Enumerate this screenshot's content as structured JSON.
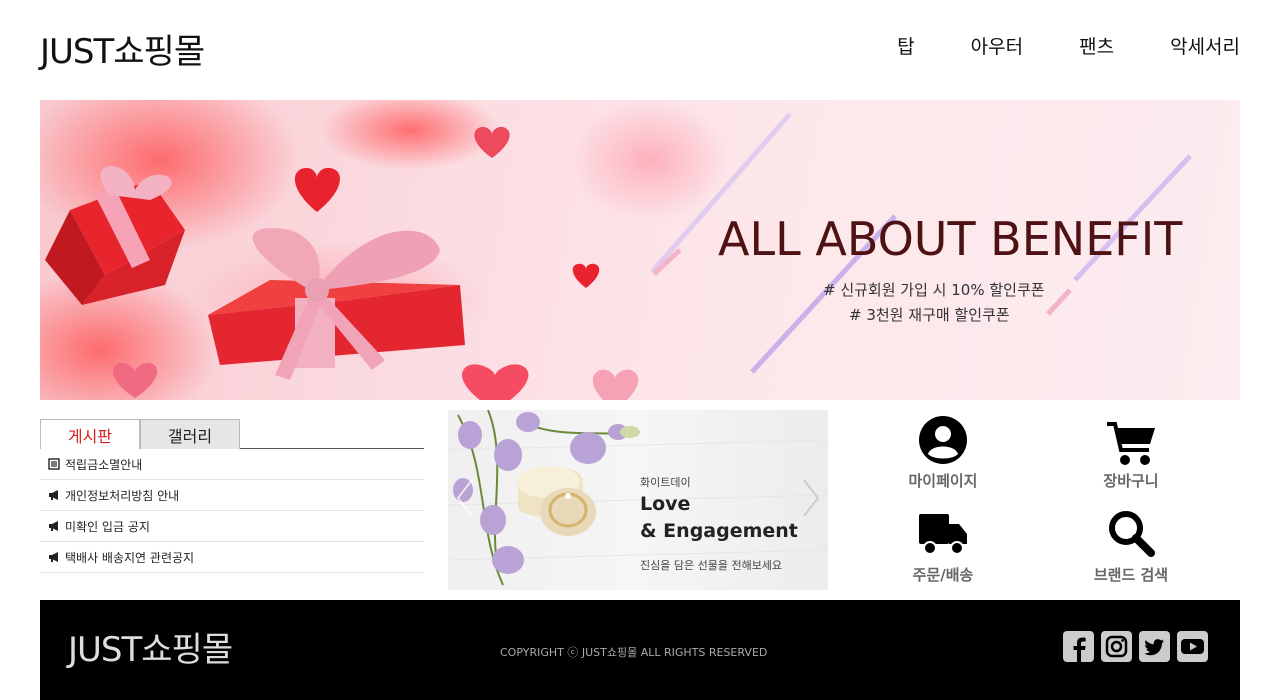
{
  "header": {
    "logo": "JUST쇼핑몰",
    "nav": [
      "탑",
      "아우터",
      "팬츠",
      "악세서리"
    ]
  },
  "banner": {
    "title": "ALL ABOUT BENEFIT",
    "line1": "# 신규회원 가입 시 10% 할인쿠폰",
    "line2": "# 3천원 재구매 할인쿠폰"
  },
  "board": {
    "tabs": [
      "게시판",
      "갤러리"
    ],
    "items": [
      {
        "icon": "list-icon",
        "text": "적립금소멸안내"
      },
      {
        "icon": "megaphone-icon",
        "text": "개인정보처리방침 안내"
      },
      {
        "icon": "megaphone-icon",
        "text": "미확인 입금 공지"
      },
      {
        "icon": "megaphone-icon",
        "text": "택배사 배송지연 관련공지"
      }
    ]
  },
  "promo": {
    "sub": "화이트데이",
    "title1": "Love",
    "title2": "&  Engagement",
    "desc": "진심을 담은 선물을 전해보세요"
  },
  "quick": [
    {
      "icon": "user-circle-icon",
      "label": "마이페이지"
    },
    {
      "icon": "cart-icon",
      "label": "장바구니"
    },
    {
      "icon": "truck-icon",
      "label": "주문/배송"
    },
    {
      "icon": "search-icon",
      "label": "브랜드 검색"
    }
  ],
  "footer": {
    "logo": "JUST쇼핑몰",
    "copyright": "COPYRIGHT ⓒ JUST쇼핑몰 ALL RIGHTS RESERVED",
    "social": [
      "facebook-icon",
      "instagram-icon",
      "twitter-icon",
      "youtube-icon"
    ]
  },
  "colors": {
    "accent_tab": "#d42020",
    "banner_title": "#4e1214",
    "footer_bg": "#000000"
  }
}
